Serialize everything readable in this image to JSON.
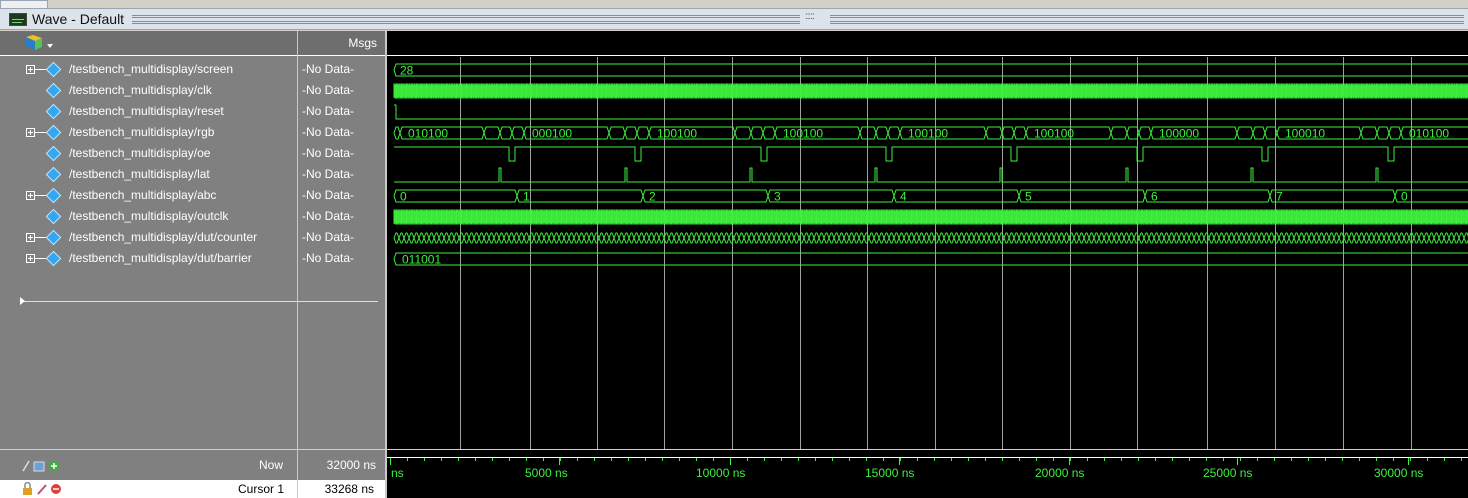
{
  "window": {
    "title": "Wave - Default",
    "grip": ":::::"
  },
  "columns": {
    "msgs_header": "Msgs"
  },
  "signals": [
    {
      "name": "/testbench_multidisplay/screen",
      "value": "-No Data-",
      "expandable": true
    },
    {
      "name": "/testbench_multidisplay/clk",
      "value": "-No Data-",
      "expandable": false
    },
    {
      "name": "/testbench_multidisplay/reset",
      "value": "-No Data-",
      "expandable": false
    },
    {
      "name": "/testbench_multidisplay/rgb",
      "value": "-No Data-",
      "expandable": true
    },
    {
      "name": "/testbench_multidisplay/oe",
      "value": "-No Data-",
      "expandable": false
    },
    {
      "name": "/testbench_multidisplay/lat",
      "value": "-No Data-",
      "expandable": false
    },
    {
      "name": "/testbench_multidisplay/abc",
      "value": "-No Data-",
      "expandable": true
    },
    {
      "name": "/testbench_multidisplay/outclk",
      "value": "-No Data-",
      "expandable": false
    },
    {
      "name": "/testbench_multidisplay/dut/counter",
      "value": "-No Data-",
      "expandable": true
    },
    {
      "name": "/testbench_multidisplay/dut/barrier",
      "value": "-No Data-",
      "expandable": true
    }
  ],
  "wave_values": {
    "screen": "28",
    "barrier": "011001",
    "rgb": [
      "010100",
      "000100",
      "100100",
      "100100",
      "100100",
      "100100",
      "100000",
      "100010",
      "010100"
    ],
    "abc": [
      "0",
      "1",
      "2",
      "3",
      "4",
      "5",
      "6",
      "7",
      "0"
    ]
  },
  "footer": {
    "now_label": "Now",
    "now_value": "32000 ns",
    "cursor_label": "Cursor 1",
    "cursor_value": "33268 ns"
  },
  "timeline": {
    "unit_start": "ns",
    "ticks": [
      "5000 ns",
      "10000 ns",
      "15000 ns",
      "20000 ns",
      "25000 ns",
      "30000 ns"
    ]
  },
  "colors": {
    "wave": "#3cf03c",
    "grid": "#a0a0a0",
    "bg": "#000000"
  }
}
